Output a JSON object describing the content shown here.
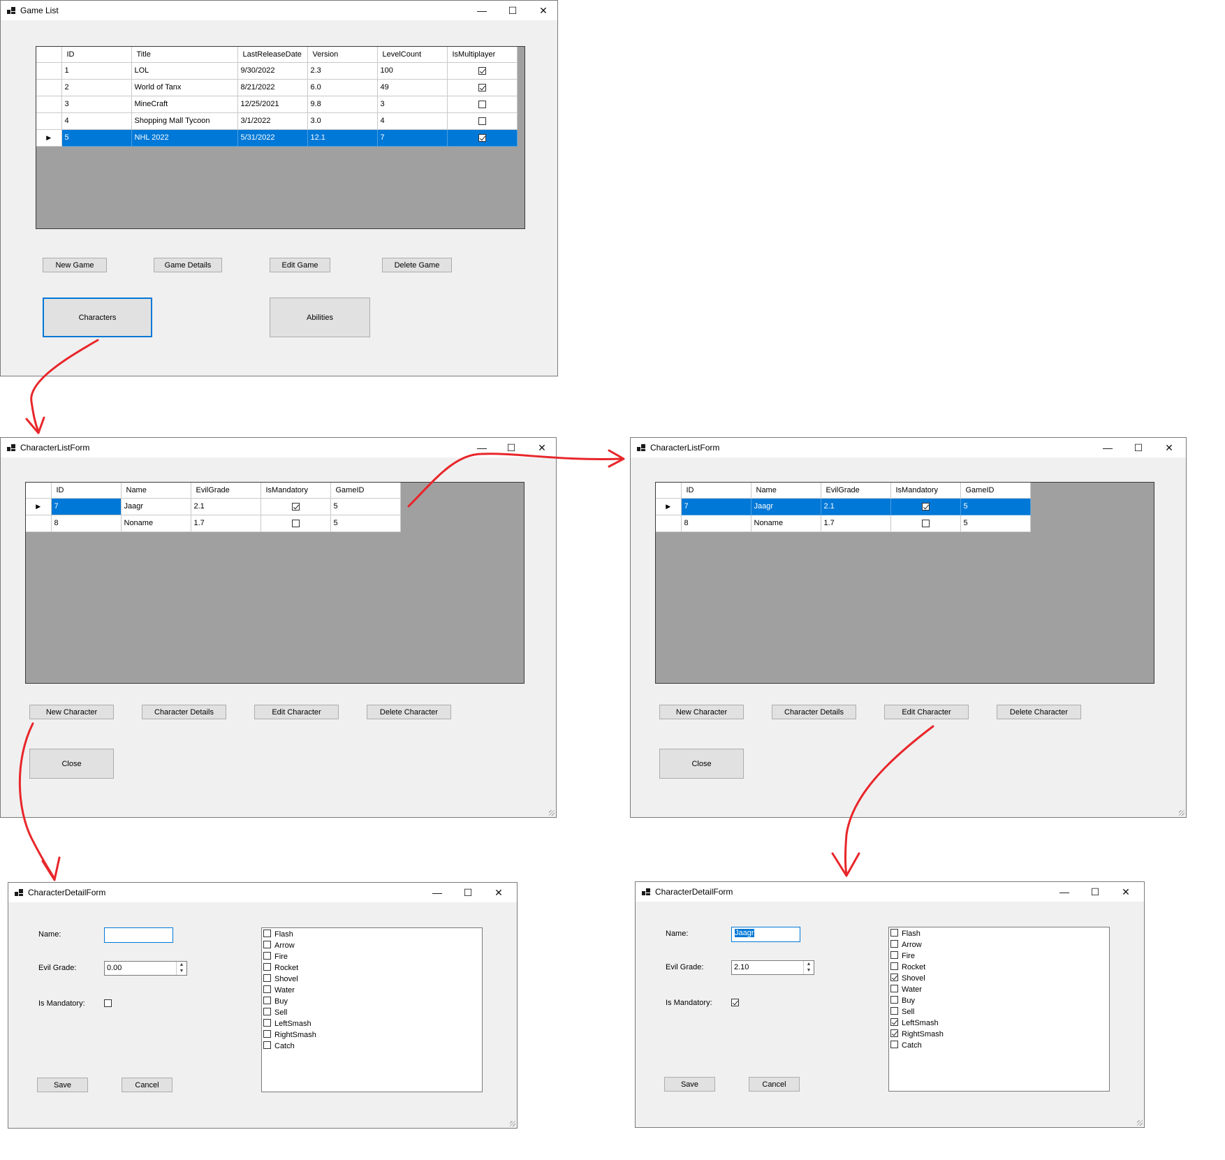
{
  "game_list": {
    "title": "Game List",
    "columns": [
      "ID",
      "Title",
      "LastReleaseDate",
      "Version",
      "LevelCount",
      "IsMultiplayer"
    ],
    "rows": [
      {
        "id": "1",
        "title": "LOL",
        "date": "9/30/2022",
        "version": "2.3",
        "levels": "100",
        "multi": true
      },
      {
        "id": "2",
        "title": "World of Tanx",
        "date": "8/21/2022",
        "version": "6.0",
        "levels": "49",
        "multi": true
      },
      {
        "id": "3",
        "title": "MineCraft",
        "date": "12/25/2021",
        "version": "9.8",
        "levels": "3",
        "multi": false
      },
      {
        "id": "4",
        "title": "Shopping Mall Tycoon",
        "date": "3/1/2022",
        "version": "3.0",
        "levels": "4",
        "multi": false
      },
      {
        "id": "5",
        "title": "NHL 2022",
        "date": "5/31/2022",
        "version": "12.1",
        "levels": "7",
        "multi": true
      }
    ],
    "buttons": {
      "new": "New Game",
      "details": "Game Details",
      "edit": "Edit Game",
      "delete": "Delete Game",
      "characters": "Characters",
      "abilities": "Abilities"
    }
  },
  "char_list_left": {
    "title": "CharacterListForm",
    "columns": [
      "ID",
      "Name",
      "EvilGrade",
      "IsMandatory",
      "GameID"
    ],
    "rows": [
      {
        "id": "7",
        "name": "Jaagr",
        "grade": "2.1",
        "mandatory": true,
        "game": "5"
      },
      {
        "id": "8",
        "name": "Noname",
        "grade": "1.7",
        "mandatory": false,
        "game": "5"
      }
    ],
    "buttons": {
      "new": "New Character",
      "details": "Character Details",
      "edit": "Edit Character",
      "delete": "Delete Character",
      "close": "Close"
    }
  },
  "char_list_right": {
    "title": "CharacterListForm",
    "columns": [
      "ID",
      "Name",
      "EvilGrade",
      "IsMandatory",
      "GameID"
    ],
    "rows": [
      {
        "id": "7",
        "name": "Jaagr",
        "grade": "2.1",
        "mandatory": true,
        "game": "5"
      },
      {
        "id": "8",
        "name": "Noname",
        "grade": "1.7",
        "mandatory": false,
        "game": "5"
      }
    ],
    "buttons": {
      "new": "New Character",
      "details": "Character Details",
      "edit": "Edit Character",
      "delete": "Delete Character",
      "close": "Close"
    }
  },
  "detail_left": {
    "title": "CharacterDetailForm",
    "name_label": "Name:",
    "name_value": "",
    "grade_label": "Evil Grade:",
    "grade_value": "0.00",
    "mandatory_label": "Is Mandatory:",
    "mandatory": false,
    "abilities": [
      {
        "label": "Flash",
        "checked": false
      },
      {
        "label": "Arrow",
        "checked": false
      },
      {
        "label": "Fire",
        "checked": false
      },
      {
        "label": "Rocket",
        "checked": false
      },
      {
        "label": "Shovel",
        "checked": false
      },
      {
        "label": "Water",
        "checked": false
      },
      {
        "label": "Buy",
        "checked": false
      },
      {
        "label": "Sell",
        "checked": false
      },
      {
        "label": "LeftSmash",
        "checked": false
      },
      {
        "label": "RightSmash",
        "checked": false
      },
      {
        "label": "Catch",
        "checked": false
      }
    ],
    "save": "Save",
    "cancel": "Cancel"
  },
  "detail_right": {
    "title": "CharacterDetailForm",
    "name_label": "Name:",
    "name_value": "Jaagr",
    "grade_label": "Evil Grade:",
    "grade_value": "2.10",
    "mandatory_label": "Is Mandatory:",
    "mandatory": true,
    "abilities": [
      {
        "label": "Flash",
        "checked": false
      },
      {
        "label": "Arrow",
        "checked": false
      },
      {
        "label": "Fire",
        "checked": false
      },
      {
        "label": "Rocket",
        "checked": false
      },
      {
        "label": "Shovel",
        "checked": true
      },
      {
        "label": "Water",
        "checked": false
      },
      {
        "label": "Buy",
        "checked": false
      },
      {
        "label": "Sell",
        "checked": false
      },
      {
        "label": "LeftSmash",
        "checked": true
      },
      {
        "label": "RightSmash",
        "checked": true
      },
      {
        "label": "Catch",
        "checked": false
      }
    ],
    "save": "Save",
    "cancel": "Cancel"
  },
  "window_controls": {
    "minimize": "—",
    "maximize": "☐",
    "close": "✕"
  },
  "colors": {
    "selection": "#0078d7",
    "arrow": "#e8262a",
    "grid_bg": "#a0a0a0"
  }
}
